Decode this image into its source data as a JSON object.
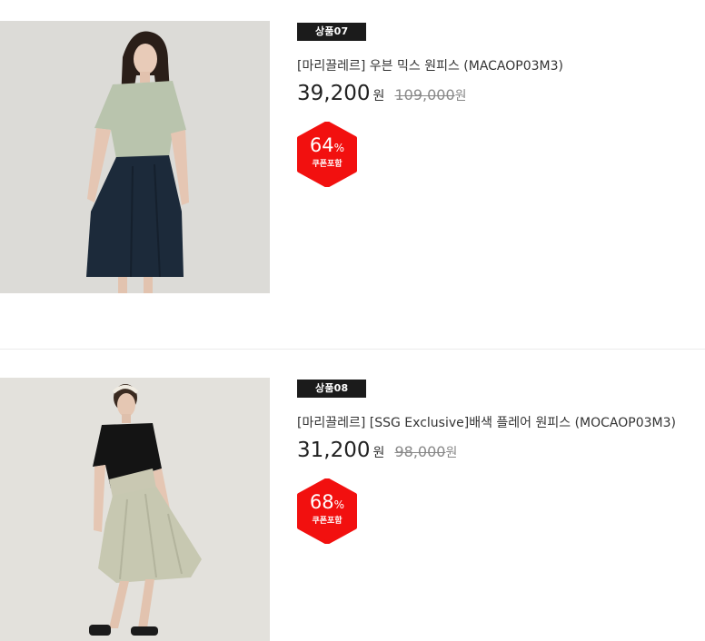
{
  "products": [
    {
      "tag": "상품07",
      "title": "[마리끌레르] 우븐 믹스 원피스 (MACAOP03M3)",
      "price": "39,200",
      "currency": "원",
      "original_price": "109,000",
      "original_currency": "원",
      "discount": "64",
      "discount_sign": "%",
      "coupon_label": "쿠폰포함"
    },
    {
      "tag": "상품08",
      "title": "[마리끌레르] [SSG Exclusive]배색 플레어 원피스 (MOCAOP03M3)",
      "price": "31,200",
      "currency": "원",
      "original_price": "98,000",
      "original_currency": "원",
      "discount": "68",
      "discount_sign": "%",
      "coupon_label": "쿠폰포함"
    }
  ],
  "colors": {
    "badge_red": "#f2100f",
    "tag_black": "#1b1b1b",
    "divider": "#ebebeb"
  }
}
